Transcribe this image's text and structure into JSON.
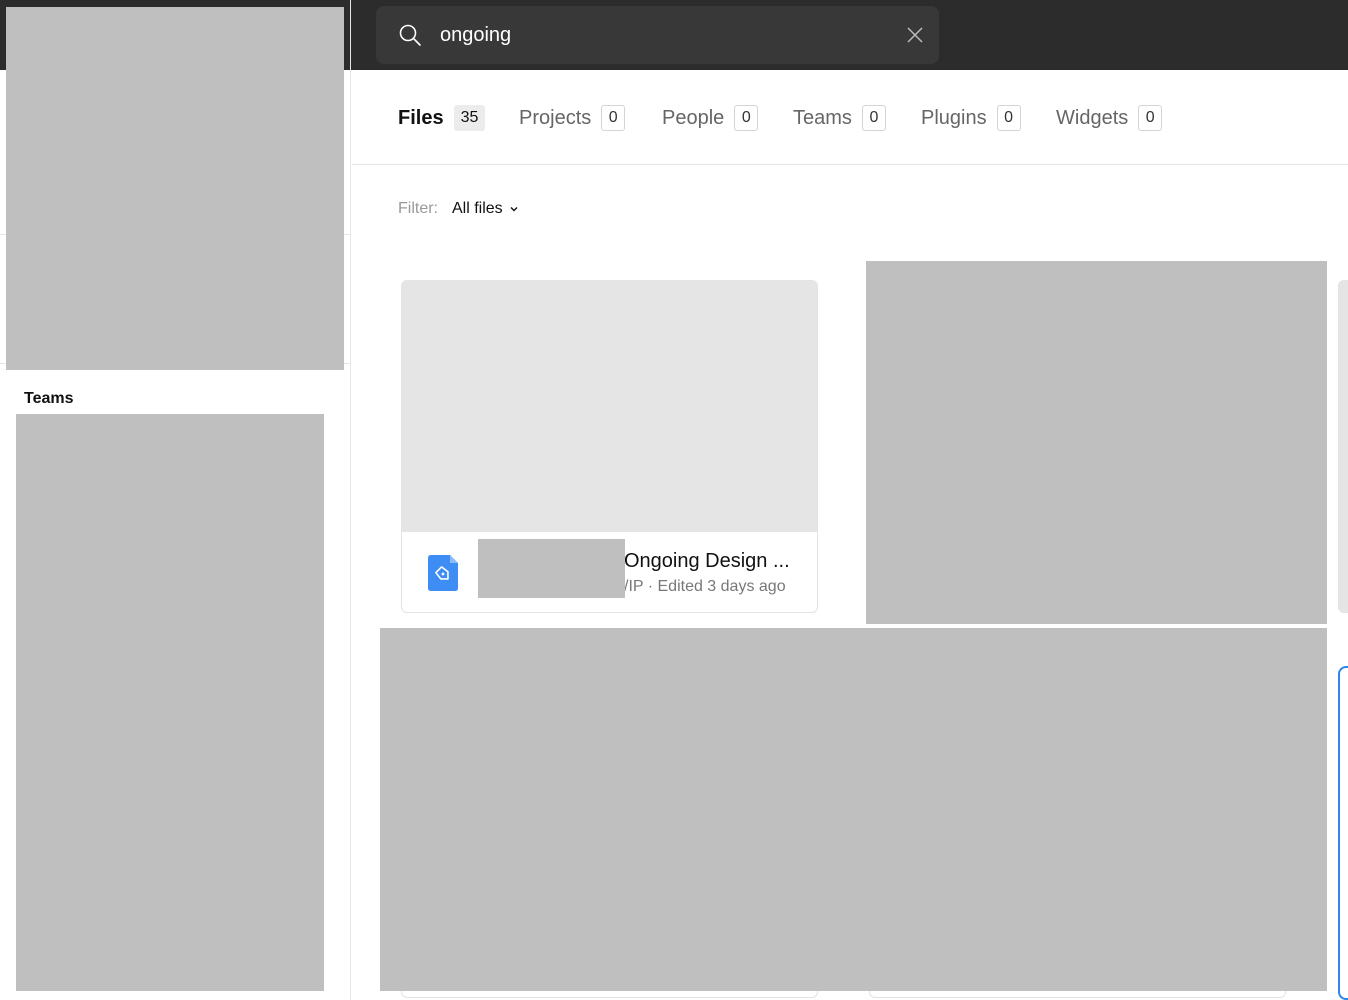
{
  "search": {
    "query": "ongoing"
  },
  "sidebar": {
    "teams_heading": "Teams"
  },
  "tabs": [
    {
      "label": "Files",
      "count": "35",
      "active": true
    },
    {
      "label": "Projects",
      "count": "0"
    },
    {
      "label": "People",
      "count": "0"
    },
    {
      "label": "Teams",
      "count": "0"
    },
    {
      "label": "Plugins",
      "count": "0"
    },
    {
      "label": "Widgets",
      "count": "0"
    }
  ],
  "filter": {
    "label": "Filter:",
    "value": "All files"
  },
  "files": [
    {
      "name": "Ongoing Design ...",
      "meta": "/IP · Edited 3 days ago",
      "icon": "design-file-icon"
    }
  ],
  "colors": {
    "topbar": "#2c2c2c",
    "search_box": "#383838",
    "accent": "#2f86e8",
    "file_icon": "#3d8df5"
  }
}
